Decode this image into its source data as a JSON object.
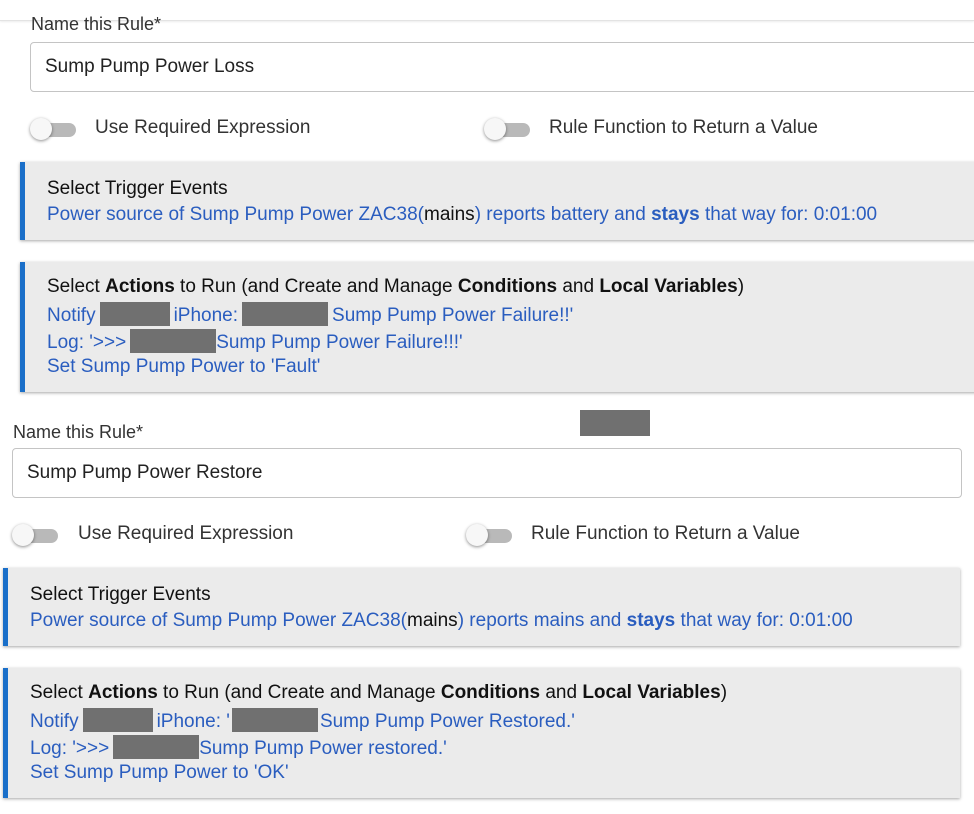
{
  "rules": [
    {
      "name_label": "Name this Rule*",
      "name_value": "Sump Pump Power Loss",
      "toggle_required": "Use Required Expression",
      "toggle_function": "Rule Function to Return a Value",
      "trigger": {
        "title": "Select Trigger Events",
        "pre": "Power source of Sump Pump Power ZAC38(",
        "mains": "mains",
        "mid": ") reports battery and ",
        "stays": "stays",
        "post": " that way for: 0:01:00"
      },
      "actions": {
        "t1": "Select ",
        "b1": "Actions",
        "t2": " to Run (and Create and Manage ",
        "b2": "Conditions",
        "t3": " and ",
        "b3": "Local Variables",
        "t4": ")",
        "notify_a": "Notify",
        "notify_b": "iPhone:",
        "notify_c": "Sump Pump Power Failure!!'",
        "log_a": "Log: '>>>",
        "log_b": "Sump Pump Power Failure!!!'",
        "set_line": "Set Sump Pump Power to 'Fault'"
      }
    },
    {
      "name_label": "Name this Rule*",
      "name_value": "Sump Pump Power Restore",
      "toggle_required": "Use Required Expression",
      "toggle_function": "Rule Function to Return a Value",
      "trigger": {
        "title": "Select Trigger Events",
        "pre": "Power source of Sump Pump Power ZAC38(",
        "mains": "mains",
        "mid": ") reports mains and ",
        "stays": "stays",
        "post": " that way for: 0:01:00"
      },
      "actions": {
        "t1": "Select ",
        "b1": "Actions",
        "t2": " to Run (and Create and Manage ",
        "b2": "Conditions",
        "t3": " and ",
        "b3": "Local Variables",
        "t4": ")",
        "notify_a": "Notify",
        "notify_b": "iPhone: '",
        "notify_c": "Sump Pump Power Restored.'",
        "log_a": "Log: '>>>",
        "log_b": "Sump Pump Power restored.'",
        "set_line": "Set Sump Pump Power to 'OK'"
      }
    }
  ]
}
